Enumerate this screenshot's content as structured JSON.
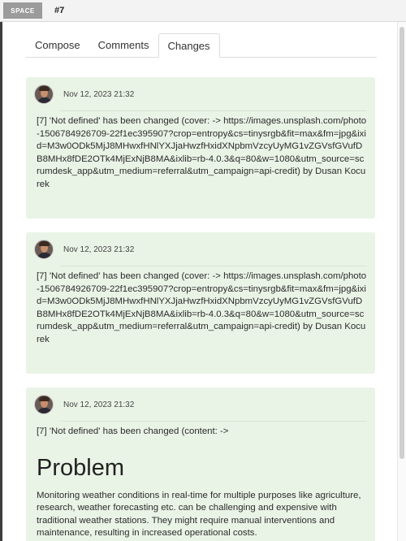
{
  "topbar": {
    "space_label": "SPACE",
    "item_id": "#7"
  },
  "tabs": [
    {
      "label": "Compose",
      "active": false
    },
    {
      "label": "Comments",
      "active": false
    },
    {
      "label": "Changes",
      "active": true
    }
  ],
  "changes": [
    {
      "date": "Nov 12, 2023 21:32",
      "text": "[7] 'Not defined' has been changed (cover: -> https://images.unsplash.com/photo-1506784926709-22f1ec395907?crop=entropy&cs=tinysrgb&fit=max&fm=jpg&ixid=M3w0ODk5MjJ8MHwxfHNlYXJjaHwzfHxidXNpbmVzcyUyMG1vZGVsfGVufDB8MHx8fDE2OTk4MjExNjB8MA&ixlib=rb-4.0.3&q=80&w=1080&utm_source=scrumdesk_app&utm_medium=referral&utm_campaign=api-credit) by Dusan Kocurek"
    },
    {
      "date": "Nov 12, 2023 21:32",
      "text": "[7] 'Not defined' has been changed (cover: -> https://images.unsplash.com/photo-1506784926709-22f1ec395907?crop=entropy&cs=tinysrgb&fit=max&fm=jpg&ixid=M3w0ODk5MjJ8MHwxfHNlYXJjaHwzfHxidXNpbmVzcyUyMG1vZGVsfGVufDB8MHx8fDE2OTk4MjExNjB8MA&ixlib=rb-4.0.3&q=80&w=1080&utm_source=scrumdesk_app&utm_medium=referral&utm_campaign=api-credit) by Dusan Kocurek"
    },
    {
      "date": "Nov 12, 2023 21:32",
      "text": "[7] 'Not defined' has been changed (content: ->",
      "heading": "Problem",
      "body": "Monitoring weather conditions in real-time for multiple purposes like agriculture, research, weather forecasting etc. can be challenging and expensive with traditional weather stations. They might require manual interventions and maintenance, resulting in increased operational costs."
    }
  ]
}
